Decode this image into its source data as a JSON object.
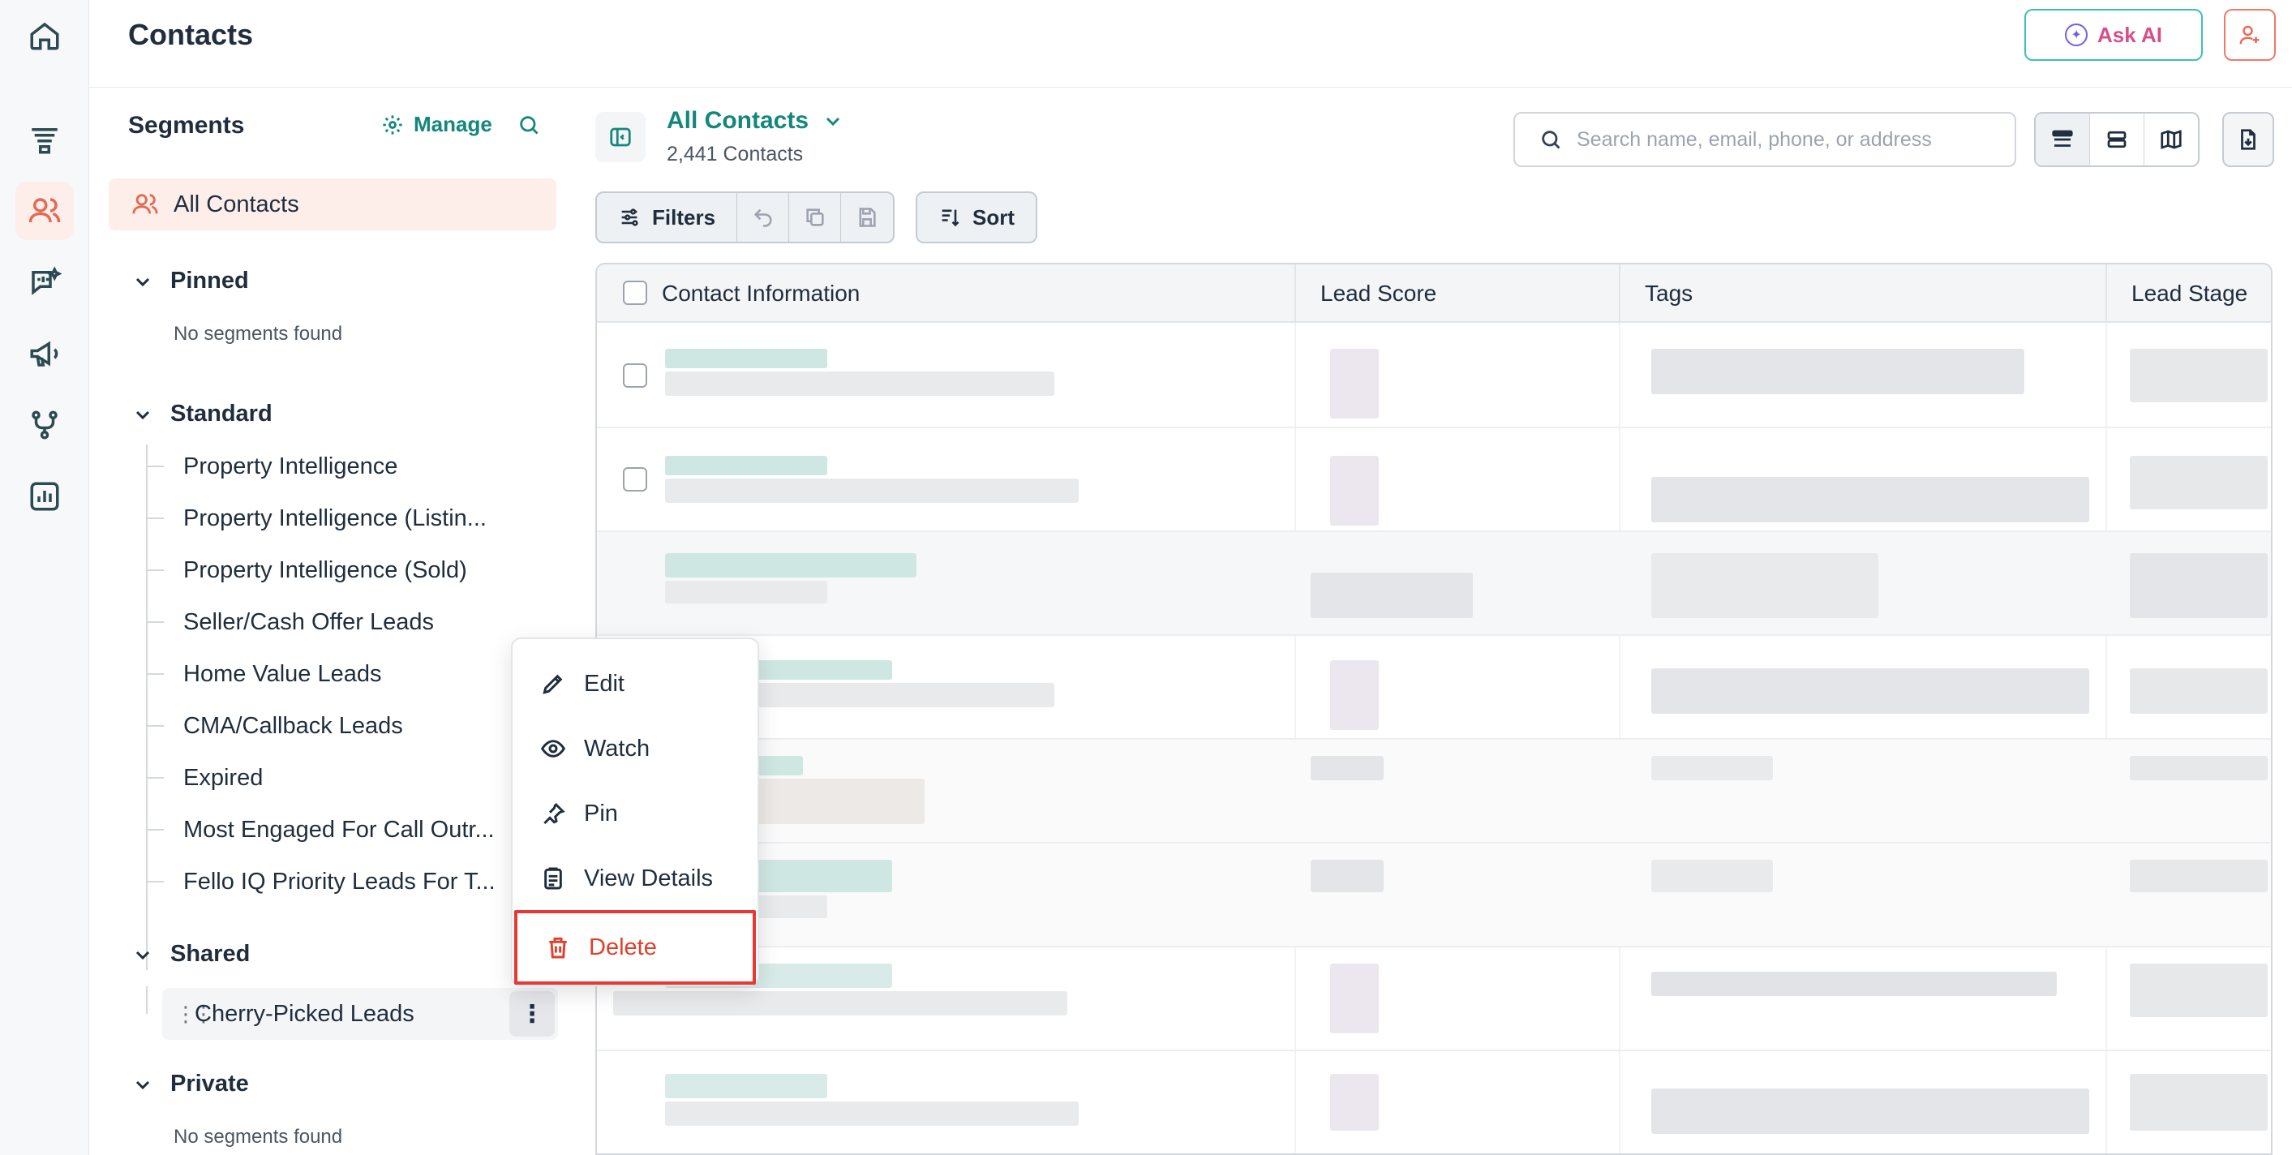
{
  "header": {
    "title": "Contacts",
    "ask_ai_label": "Ask AI"
  },
  "segments": {
    "title": "Segments",
    "manage_label": "Manage",
    "all_contacts_label": "All Contacts",
    "groups": {
      "pinned": {
        "label": "Pinned",
        "empty_text": "No segments found"
      },
      "standard": {
        "label": "Standard",
        "items": [
          "Property Intelligence",
          "Property Intelligence (Listin...",
          "Property Intelligence (Sold)",
          "Seller/Cash Offer Leads",
          "Home Value Leads",
          "CMA/Callback Leads",
          "Expired",
          "Most Engaged For Call Outr...",
          "Fello IQ Priority Leads For T..."
        ]
      },
      "shared": {
        "label": "Shared",
        "items": [
          "Cherry-Picked Leads"
        ]
      },
      "private": {
        "label": "Private",
        "empty_text": "No segments found"
      }
    }
  },
  "main": {
    "view_name": "All Contacts",
    "view_count": "2,441 Contacts",
    "search_placeholder": "Search name, email, phone, or address",
    "filters_label": "Filters",
    "sort_label": "Sort",
    "columns": [
      "Contact Information",
      "Lead Score",
      "Tags",
      "Lead Stage"
    ]
  },
  "context_menu": {
    "items": [
      "Edit",
      "Watch",
      "Pin",
      "View Details",
      "Delete"
    ],
    "highlighted": "Delete"
  },
  "colors": {
    "brand_teal": "#14877d",
    "accent_coral": "#e36a55",
    "danger": "#e53935"
  }
}
